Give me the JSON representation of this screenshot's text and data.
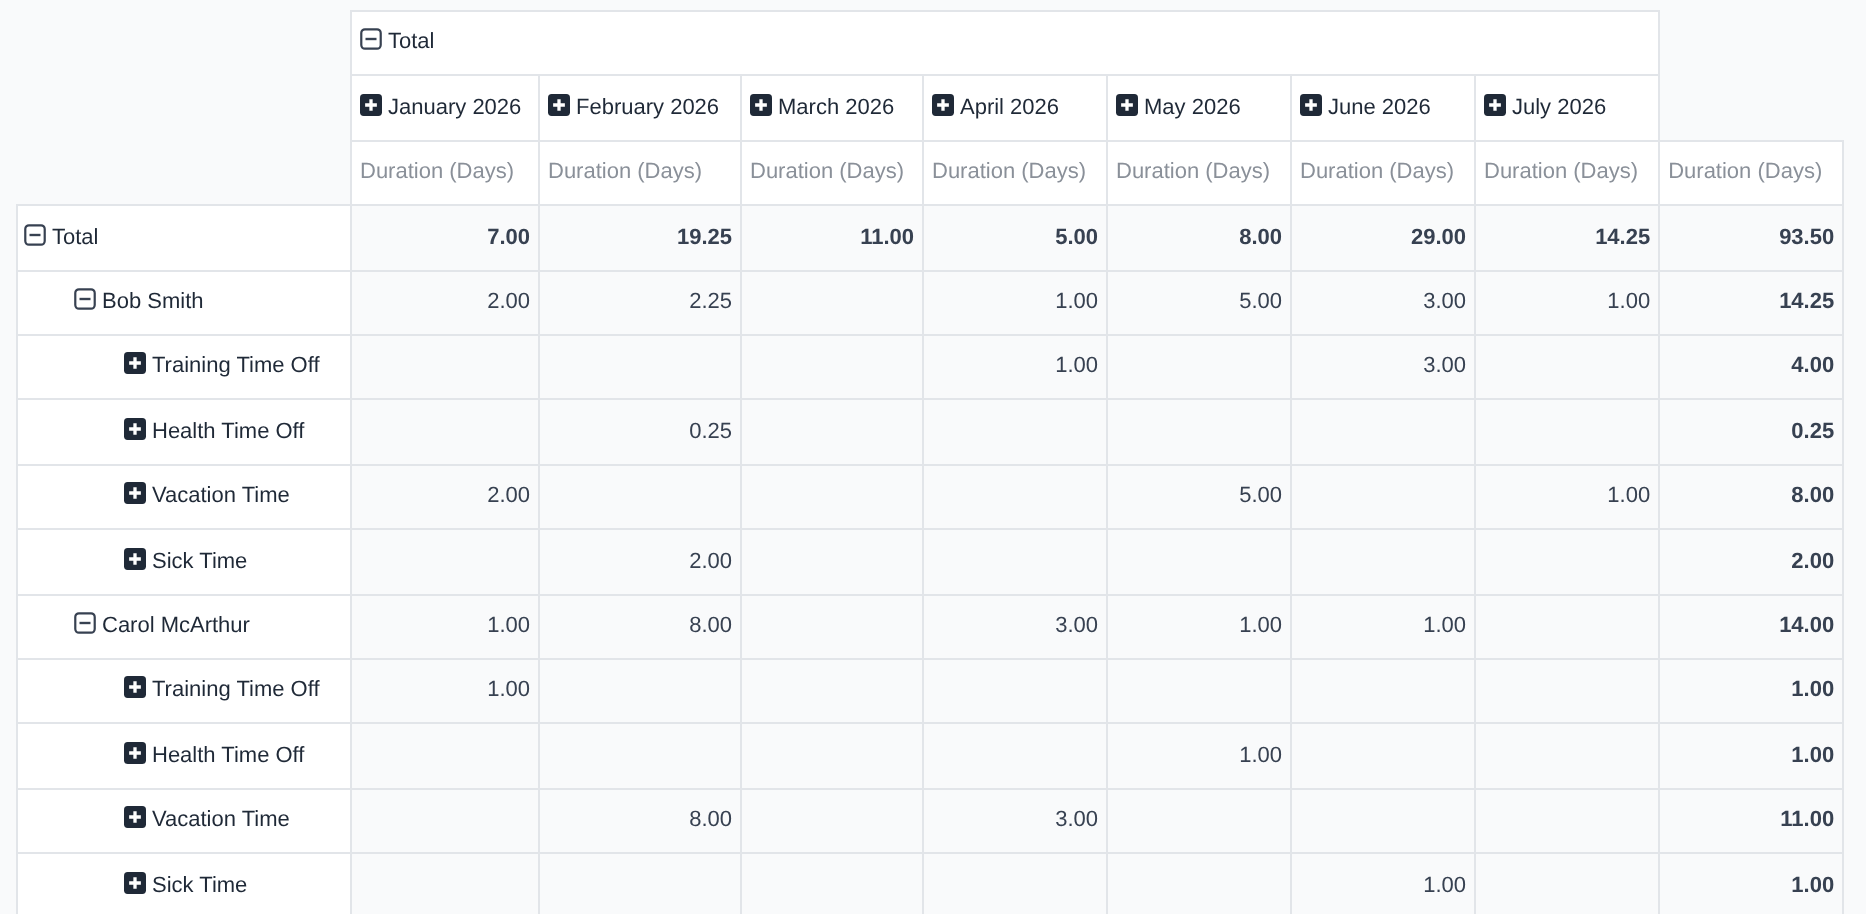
{
  "column_header": {
    "label": "Total",
    "expanded": true
  },
  "columns": [
    {
      "label": "January 2026",
      "expanded": false
    },
    {
      "label": "February 2026",
      "expanded": false
    },
    {
      "label": "March 2026",
      "expanded": false
    },
    {
      "label": "April 2026",
      "expanded": false
    },
    {
      "label": "May 2026",
      "expanded": false
    },
    {
      "label": "June 2026",
      "expanded": false
    },
    {
      "label": "July 2026",
      "expanded": false
    }
  ],
  "measures": [
    "Duration (Days)",
    "Duration (Days)",
    "Duration (Days)",
    "Duration (Days)",
    "Duration (Days)",
    "Duration (Days)",
    "Duration (Days)",
    "Duration (Days)"
  ],
  "rows": [
    {
      "label": "Total",
      "expanded": true,
      "cells": [
        {
          "value": "7.00"
        },
        {
          "value": "19.25"
        },
        {
          "value": "11.00"
        },
        {
          "value": "5.00"
        },
        {
          "value": "8.00"
        },
        {
          "value": "29.00"
        },
        {
          "value": "14.25"
        },
        {
          "value": "93.50"
        }
      ],
      "children": [
        {
          "label": "Bob Smith",
          "expanded": true,
          "cells": [
            {
              "value": "2.00"
            },
            {
              "value": "2.25"
            },
            {},
            {
              "value": "1.00"
            },
            {
              "value": "5.00"
            },
            {
              "value": "3.00"
            },
            {
              "value": "1.00"
            },
            {
              "value": "14.25"
            }
          ],
          "children": [
            {
              "label": "Training Time Off",
              "expanded": false,
              "cells": [
                {},
                {},
                {},
                {
                  "value": "1.00"
                },
                {},
                {
                  "value": "3.00"
                },
                {},
                {
                  "value": "4.00"
                }
              ]
            },
            {
              "label": "Health Time Off",
              "expanded": false,
              "cells": [
                {},
                {
                  "value": "0.25"
                },
                {},
                {},
                {},
                {},
                {},
                {
                  "value": "0.25"
                }
              ]
            },
            {
              "label": "Vacation Time",
              "expanded": false,
              "cells": [
                {
                  "value": "2.00"
                },
                {},
                {},
                {},
                {
                  "value": "5.00"
                },
                {},
                {
                  "value": "1.00"
                },
                {
                  "value": "8.00"
                }
              ]
            },
            {
              "label": "Sick Time",
              "expanded": false,
              "cells": [
                {},
                {
                  "value": "2.00"
                },
                {},
                {},
                {},
                {},
                {},
                {
                  "value": "2.00"
                }
              ]
            }
          ]
        },
        {
          "label": "Carol McArthur",
          "expanded": true,
          "cells": [
            {
              "value": "1.00"
            },
            {
              "value": "8.00"
            },
            {},
            {
              "value": "3.00"
            },
            {
              "value": "1.00"
            },
            {
              "value": "1.00"
            },
            {},
            {
              "value": "14.00"
            }
          ],
          "children": [
            {
              "label": "Training Time Off",
              "expanded": false,
              "cells": [
                {
                  "value": "1.00"
                },
                {},
                {},
                {},
                {},
                {},
                {},
                {
                  "value": "1.00"
                }
              ]
            },
            {
              "label": "Health Time Off",
              "expanded": false,
              "cells": [
                {},
                {},
                {},
                {},
                {
                  "value": "1.00"
                },
                {},
                {},
                {
                  "value": "1.00"
                }
              ]
            },
            {
              "label": "Vacation Time",
              "expanded": false,
              "cells": [
                {},
                {
                  "value": "8.00"
                },
                {},
                {
                  "value": "3.00"
                },
                {},
                {},
                {},
                {
                  "value": "11.00"
                }
              ]
            },
            {
              "label": "Sick Time",
              "expanded": false,
              "cells": [
                {},
                {},
                {},
                {},
                {},
                {
                  "value": "1.00"
                },
                {},
                {
                  "value": "1.00"
                }
              ]
            }
          ]
        }
      ]
    }
  ]
}
